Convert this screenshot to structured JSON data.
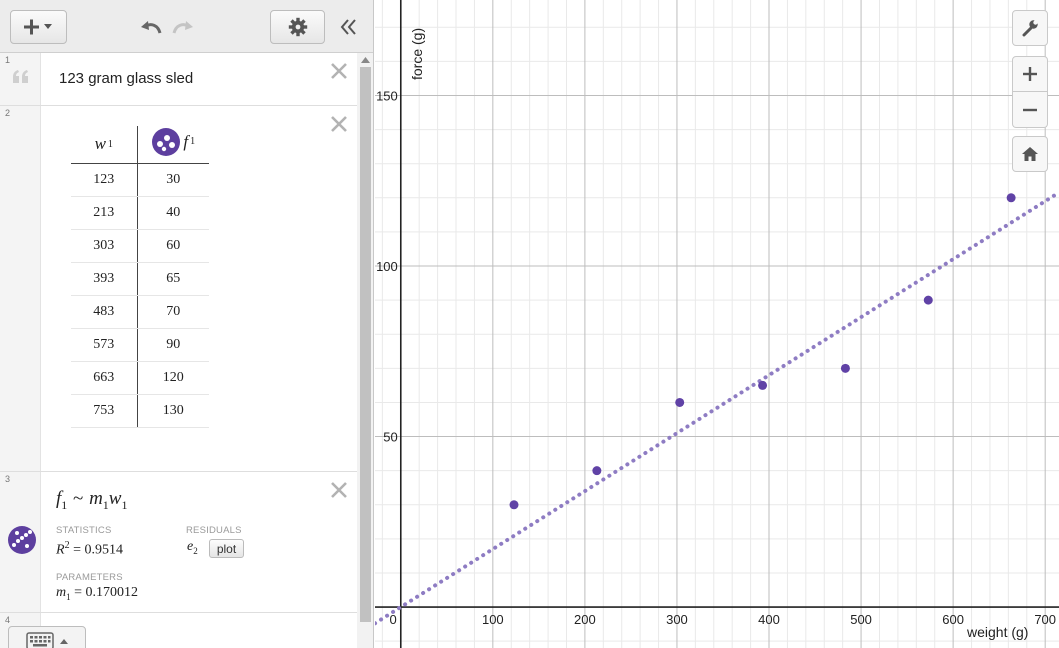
{
  "toolbar": {
    "add_icon": "plus-caret-icon",
    "undo_icon": "undo-icon",
    "redo_icon": "redo-icon",
    "settings_icon": "gear-icon",
    "collapse_icon": "double-chevron-left-icon"
  },
  "expressions": [
    {
      "num": "1",
      "type": "note",
      "text": "123 gram glass sled"
    },
    {
      "num": "2",
      "type": "table",
      "columns": [
        {
          "var": "w",
          "sub": "1"
        },
        {
          "var": "f",
          "sub": "1"
        }
      ],
      "rows": [
        [
          "123",
          "30"
        ],
        [
          "213",
          "40"
        ],
        [
          "303",
          "60"
        ],
        [
          "393",
          "65"
        ],
        [
          "483",
          "70"
        ],
        [
          "573",
          "90"
        ],
        [
          "663",
          "120"
        ],
        [
          "753",
          "130"
        ]
      ]
    },
    {
      "num": "3",
      "type": "regression",
      "lhs": "f",
      "lhs_sub": "1",
      "op": "~",
      "coef": "m",
      "coef_sub": "1",
      "var": "w",
      "var_sub": "1",
      "statistics_label": "STATISTICS",
      "r2_label": "R",
      "r2_sup": "2",
      "r2_value": "= 0.9514",
      "residuals_label": "RESIDUALS",
      "residual_var": "e",
      "residual_sub": "2",
      "plot_label": "plot",
      "parameters_label": "PARAMETERS",
      "param_name": "m",
      "param_sub": "1",
      "param_value": "= 0.170012"
    },
    {
      "num": "4",
      "type": "empty"
    }
  ],
  "graph": {
    "x_axis_label": "weight (g)",
    "y_axis_label": "force (g)",
    "x_ticks": [
      "0",
      "100",
      "200",
      "300",
      "400",
      "500",
      "600",
      "700"
    ],
    "y_ticks": [
      "50",
      "100",
      "150"
    ],
    "side_buttons": [
      "wrench-icon",
      "plus-icon",
      "minus-icon",
      "home-icon"
    ],
    "series_color": "#6042a6",
    "regression_color": "#8e7cc3"
  },
  "chart_data": {
    "type": "scatter",
    "xlabel": "weight (g)",
    "ylabel": "force (g)",
    "xlim": [
      -28,
      715
    ],
    "ylim": [
      -12,
      178
    ],
    "x_ticks": [
      0,
      100,
      200,
      300,
      400,
      500,
      600,
      700
    ],
    "y_ticks": [
      50,
      100,
      150
    ],
    "series": [
      {
        "points": [
          [
            123,
            30
          ],
          [
            213,
            40
          ],
          [
            303,
            60
          ],
          [
            393,
            65
          ],
          [
            483,
            70
          ],
          [
            573,
            90
          ],
          [
            663,
            120
          ],
          [
            753,
            130
          ]
        ]
      }
    ],
    "regression": {
      "model": "f1 ~ m1 w1",
      "slope": 0.170012,
      "style": "dotted"
    },
    "grid": true
  }
}
